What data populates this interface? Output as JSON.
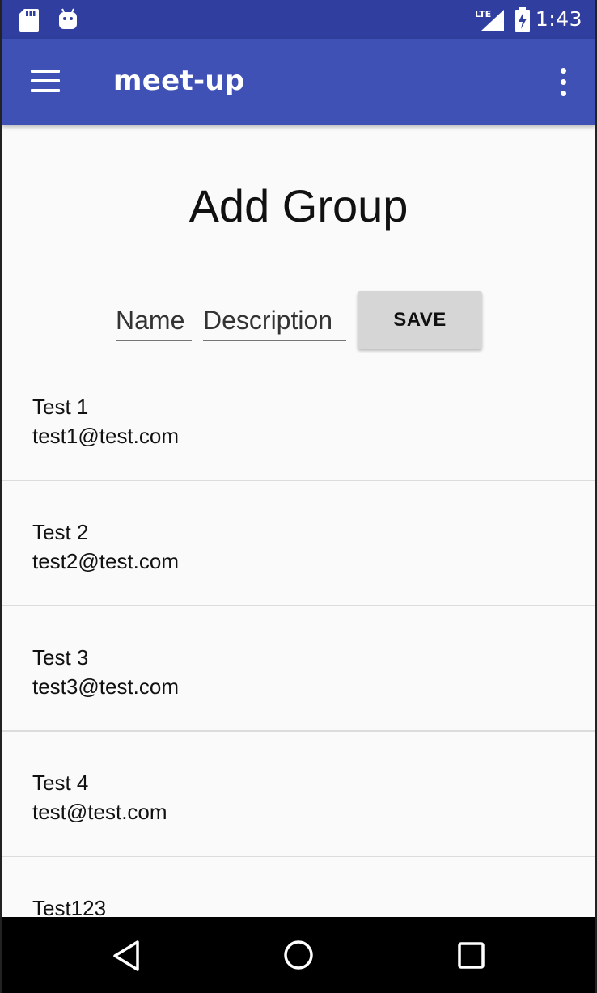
{
  "status_bar": {
    "time": "1:43",
    "network": "LTE",
    "icons": [
      "sd-card-icon",
      "android-icon",
      "lte-signal-icon",
      "battery-charging-icon"
    ]
  },
  "app_bar": {
    "title": "meet-up",
    "menu_icon": "hamburger-menu-icon",
    "overflow_icon": "more-vert-icon"
  },
  "page": {
    "title": "Add Group"
  },
  "form": {
    "name_placeholder": "Name",
    "description_placeholder": "Description",
    "save_label": "SAVE"
  },
  "list": {
    "items": [
      {
        "name": "Test 1",
        "email": "test1@test.com"
      },
      {
        "name": "Test 2",
        "email": "test2@test.com"
      },
      {
        "name": "Test 3",
        "email": "test3@test.com"
      },
      {
        "name": "Test 4",
        "email": "test@test.com"
      },
      {
        "name": "Test123",
        "email": ""
      }
    ]
  },
  "nav_bar": {
    "icons": [
      "back-icon",
      "home-icon",
      "recents-icon"
    ]
  },
  "colors": {
    "status_bar": "#303f9f",
    "app_bar": "#3f51b5",
    "background": "#fafafa",
    "button": "#d6d6d6"
  }
}
